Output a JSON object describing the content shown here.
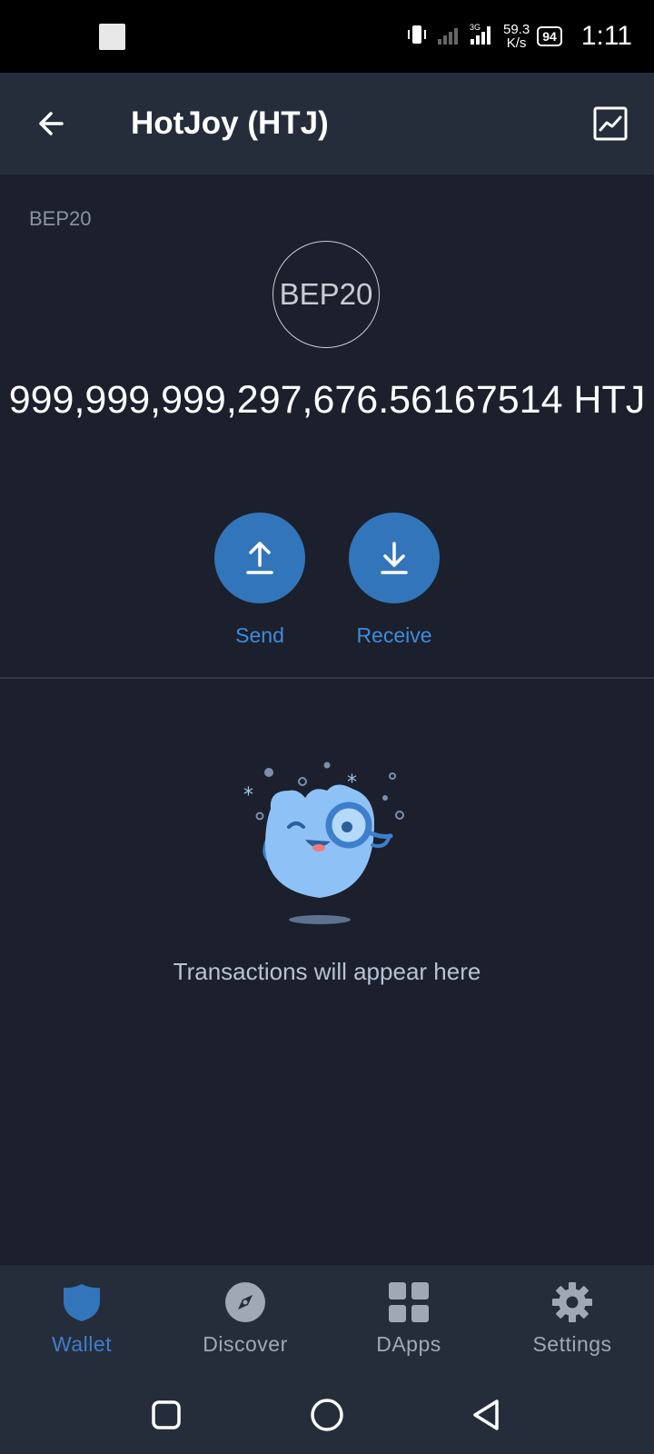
{
  "status_bar": {
    "speed_value": "59.3",
    "speed_unit": "K/s",
    "network": "3G",
    "battery": "94",
    "time": "1:11"
  },
  "header": {
    "title": "HotJoy (HTJ)",
    "back_icon": "arrow-left-icon",
    "chart_icon": "chart-icon"
  },
  "token": {
    "network_tag": "BEP20",
    "logo_text": "BEP20",
    "balance": "999,999,999,297,676.56167514 HTJ"
  },
  "actions": {
    "send_label": "Send",
    "receive_label": "Receive"
  },
  "empty_state": {
    "text": "Transactions will appear here"
  },
  "bottom_nav": {
    "items": [
      {
        "label": "Wallet",
        "icon": "shield-icon",
        "active": true
      },
      {
        "label": "Discover",
        "icon": "compass-icon",
        "active": false
      },
      {
        "label": "DApps",
        "icon": "grid-icon",
        "active": false
      },
      {
        "label": "Settings",
        "icon": "gear-icon",
        "active": false
      }
    ]
  },
  "colors": {
    "background": "#1b202c",
    "header": "#252d3a",
    "accent": "#3375bb",
    "active_nav": "#3d7fcc"
  }
}
